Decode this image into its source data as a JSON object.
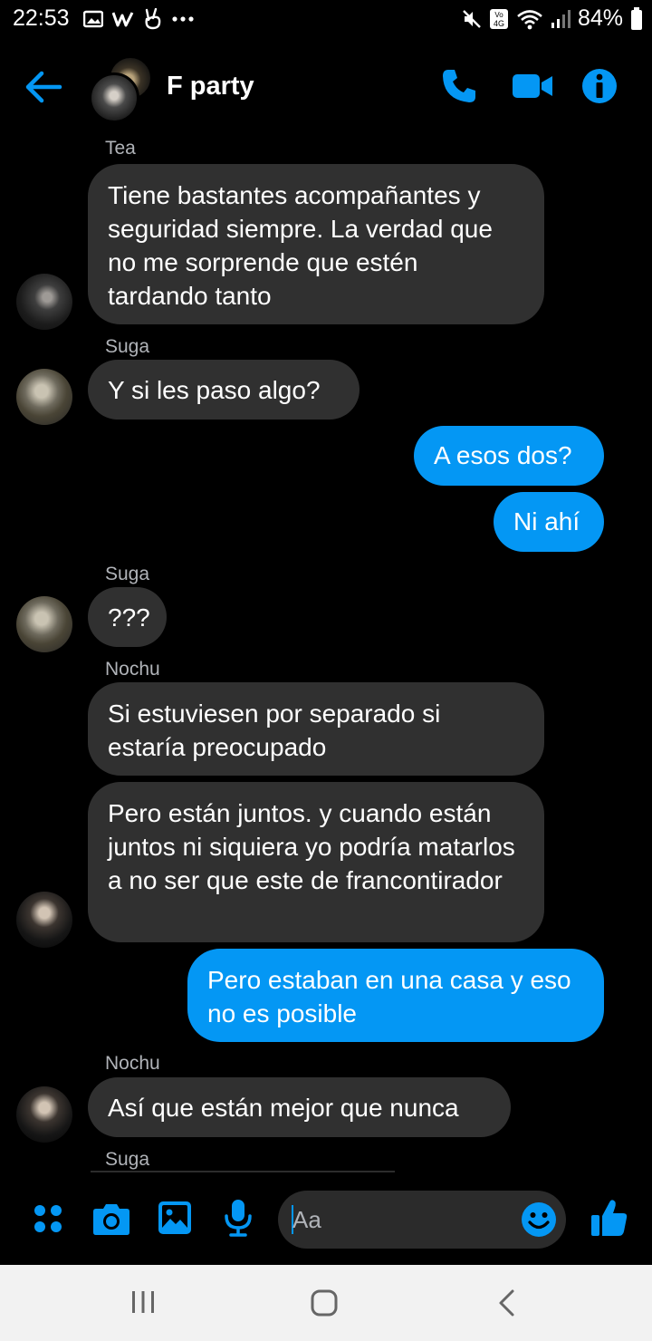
{
  "status_bar": {
    "time": "22:53",
    "left_icons": [
      "gallery-icon",
      "w-app-icon",
      "peace-hand-icon",
      "more-dots-icon"
    ],
    "right_icons": [
      "mute-icon",
      "volte-4g-icon",
      "wifi-icon",
      "signal-icon",
      "battery-icon"
    ],
    "battery": "84%"
  },
  "header": {
    "title": "F party",
    "buttons": [
      "back-arrow-icon",
      "phone-icon",
      "video-icon",
      "info-icon"
    ]
  },
  "messages": [
    {
      "sender": "Tea",
      "text": "Tiene bastantes acompañantes y seguridad siempre. La verdad que no me sorprende que estén tardando tanto",
      "direction": "in"
    },
    {
      "sender": "Suga",
      "text": "Y si les paso algo?",
      "direction": "in"
    },
    {
      "text": "A esos dos?",
      "direction": "out"
    },
    {
      "text": "Ni ahí",
      "direction": "out"
    },
    {
      "sender": "Suga",
      "text": "???",
      "direction": "in"
    },
    {
      "sender": "Nochu",
      "text": "Si estuviesen por separado si estaría preocupado",
      "direction": "in"
    },
    {
      "text": "Pero están juntos. y cuando están juntos ni siquiera yo podría matarlos a no ser que este de francontirador",
      "direction": "in"
    },
    {
      "text": "Pero estaban en una casa y eso no es posible",
      "direction": "out"
    },
    {
      "sender": "Nochu",
      "text": "Así que están mejor que nunca",
      "direction": "in"
    },
    {
      "sender": "Suga",
      "text": "",
      "direction": "in"
    }
  ],
  "composer": {
    "placeholder": "Aa",
    "icons": [
      "apps-grid-icon",
      "camera-icon",
      "image-icon",
      "microphone-icon",
      "emoji-icon",
      "thumbs-up-icon"
    ]
  },
  "nav_bar": {
    "buttons": [
      "recent-apps-icon",
      "home-icon",
      "back-icon"
    ]
  },
  "colors": {
    "accent": "#0497f4",
    "incoming_bubble": "#303030",
    "background": "#000000",
    "sender_label": "#b0b3b8"
  }
}
